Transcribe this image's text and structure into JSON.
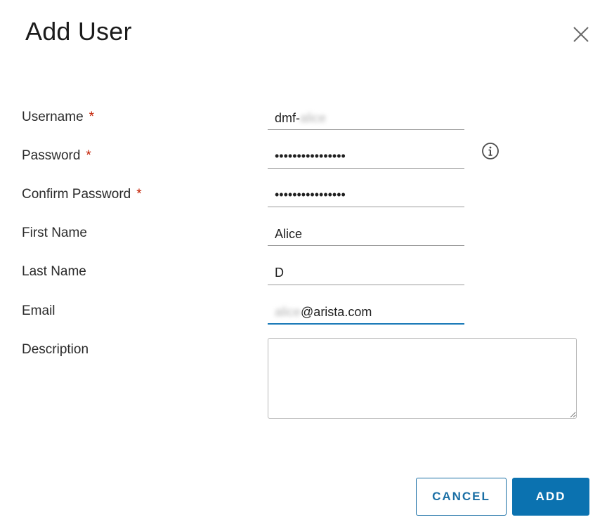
{
  "dialog": {
    "title": "Add User",
    "close_icon": "close-icon"
  },
  "form": {
    "username": {
      "label": "Username",
      "required_mark": "*",
      "value_prefix": "dmf-",
      "value_obscured": "alice"
    },
    "password": {
      "label": "Password",
      "required_mark": "*",
      "value": "••••••••••••••••"
    },
    "confirm_password": {
      "label": "Confirm Password",
      "required_mark": "*",
      "value": "••••••••••••••••"
    },
    "first_name": {
      "label": "First Name",
      "value": "Alice"
    },
    "last_name": {
      "label": "Last Name",
      "value": "D"
    },
    "email": {
      "label": "Email",
      "value_obscured": "alice",
      "value_suffix": "@arista.com"
    },
    "description": {
      "label": "Description",
      "value": ""
    },
    "info_icon": "info-icon"
  },
  "footer": {
    "cancel_label": "CANCEL",
    "add_label": "ADD"
  },
  "colors": {
    "required": "#c21d00",
    "accent": "#0b72b0",
    "active_underline": "#1a7ab8"
  }
}
